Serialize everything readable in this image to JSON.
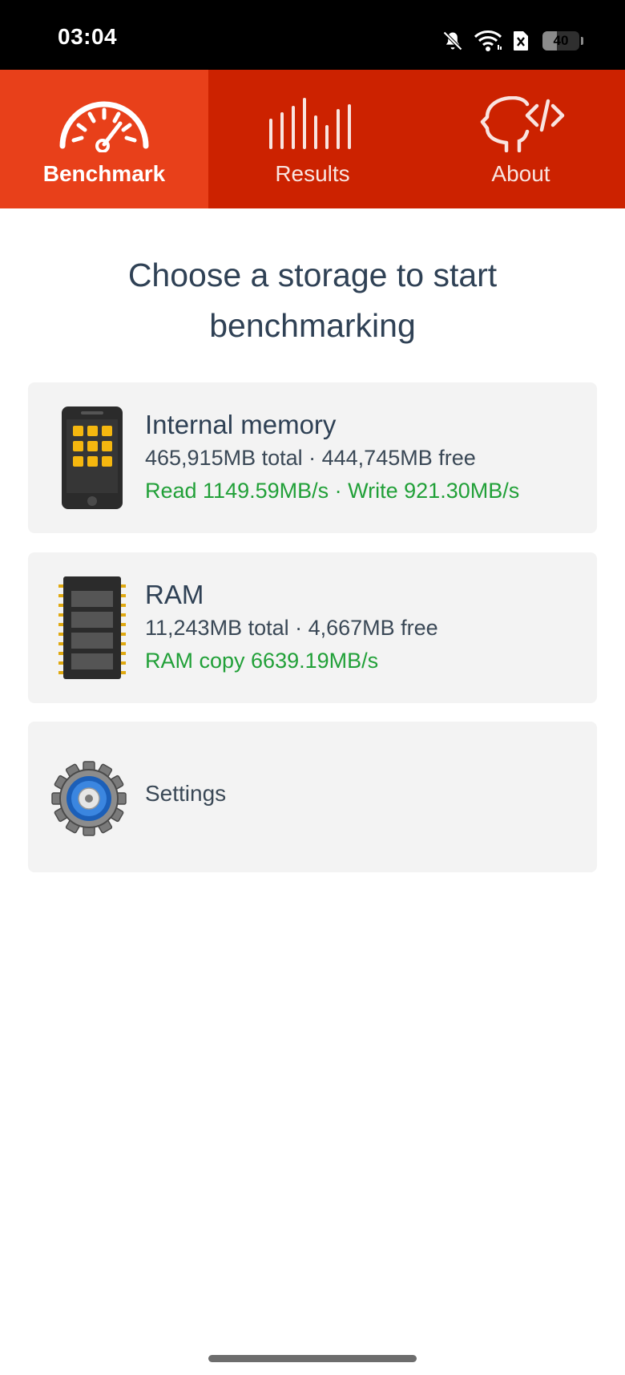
{
  "status_bar": {
    "time": "03:04",
    "icons": [
      "bell-off-icon",
      "wifi-icon",
      "sim-blocked-icon",
      "battery-icon"
    ],
    "battery_level": "40"
  },
  "tabs": [
    {
      "label": "Benchmark",
      "icon": "speedometer-icon",
      "active": true
    },
    {
      "label": "Results",
      "icon": "bars-icon",
      "active": false
    },
    {
      "label": "About",
      "icon": "head-code-icon",
      "active": false
    }
  ],
  "heading": "Choose a storage to start benchmarking",
  "cards": {
    "internal": {
      "title": "Internal memory",
      "capacity": "465,915MB total · 444,745MB free",
      "speed": "Read 1149.59MB/s · Write 921.30MB/s",
      "icon": "phone-icon"
    },
    "ram": {
      "title": "RAM",
      "capacity": "11,243MB total · 4,667MB free",
      "speed": "RAM copy 6639.19MB/s",
      "icon": "memory-chip-icon"
    },
    "settings": {
      "label": "Settings",
      "icon": "gear-icon"
    }
  },
  "colors": {
    "tab_bar": "#cc2200",
    "tab_active": "#e8401a",
    "heading_text": "#2f4155",
    "speed_text": "#21a038",
    "card_bg": "#f3f3f3"
  }
}
